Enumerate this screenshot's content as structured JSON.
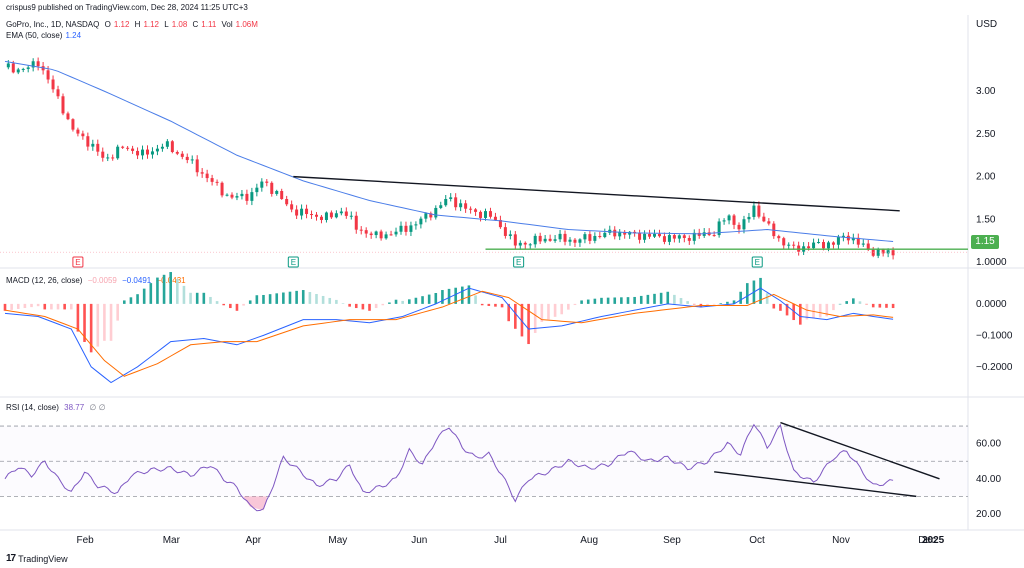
{
  "publisher": "crispus9 published on TradingView.com, Dec 28, 2024 11:25 UTC+3",
  "brand": "TradingView",
  "colors": {
    "up": "#089981",
    "down": "#f23645",
    "ema": "#4a7de8",
    "macd": "#2962ff",
    "signal": "#ff6d00",
    "rsi": "#7e57c2",
    "support": "#4caf50"
  },
  "header": {
    "symbol": "GoPro, Inc., 1D, NASDAQ",
    "o_label": "O",
    "o": "1.12",
    "h_label": "H",
    "h": "1.12",
    "l_label": "L",
    "l": "1.08",
    "c_label": "C",
    "c": "1.11",
    "vol_label": "Vol",
    "vol": "1.06M",
    "ema_label": "EMA (50, close)",
    "ema": "1.24"
  },
  "macd_header": {
    "label": "MACD (12, 26, close)",
    "hist": "−0.0059",
    "macd": "−0.0491",
    "signal": "−0.0431"
  },
  "rsi_header": {
    "label": "RSI (14, close)",
    "value": "38.77",
    "extra": "∅ ∅"
  },
  "currency": "USD",
  "price_tag": "1.15",
  "earnings_marker": "E",
  "chart_data": [
    {
      "type": "candlestick",
      "title": "GoPro, Inc., 1D, NASDAQ",
      "y_ticks": [
        "3.00",
        "2.50",
        "2.00",
        "1.50",
        "1.0000"
      ],
      "ylim": [
        1.0,
        3.6
      ],
      "x_labels": [
        "Feb",
        "Mar",
        "Apr",
        "May",
        "Jun",
        "Jul",
        "Aug",
        "Sep",
        "Oct",
        "Nov",
        "Dec",
        "2025"
      ],
      "price_anchors": [
        {
          "d": 0,
          "c": 3.28
        },
        {
          "d": 6,
          "c": 3.25
        },
        {
          "d": 10,
          "c": 3.35
        },
        {
          "d": 14,
          "c": 3.05
        },
        {
          "d": 17,
          "c": 2.85
        },
        {
          "d": 20,
          "c": 2.55
        },
        {
          "d": 24,
          "c": 2.45
        },
        {
          "d": 30,
          "c": 2.2
        },
        {
          "d": 36,
          "c": 2.35
        },
        {
          "d": 42,
          "c": 2.25
        },
        {
          "d": 48,
          "c": 2.38
        },
        {
          "d": 55,
          "c": 2.2
        },
        {
          "d": 62,
          "c": 1.95
        },
        {
          "d": 68,
          "c": 1.75
        },
        {
          "d": 74,
          "c": 1.78
        },
        {
          "d": 78,
          "c": 1.95
        },
        {
          "d": 82,
          "c": 1.8
        },
        {
          "d": 86,
          "c": 1.62
        },
        {
          "d": 92,
          "c": 1.55
        },
        {
          "d": 98,
          "c": 1.52
        },
        {
          "d": 102,
          "c": 1.62
        },
        {
          "d": 106,
          "c": 1.4
        },
        {
          "d": 112,
          "c": 1.3
        },
        {
          "d": 118,
          "c": 1.35
        },
        {
          "d": 124,
          "c": 1.45
        },
        {
          "d": 130,
          "c": 1.62
        },
        {
          "d": 134,
          "c": 1.75
        },
        {
          "d": 140,
          "c": 1.6
        },
        {
          "d": 146,
          "c": 1.55
        },
        {
          "d": 150,
          "c": 1.4
        },
        {
          "d": 154,
          "c": 1.2
        },
        {
          "d": 160,
          "c": 1.25
        },
        {
          "d": 166,
          "c": 1.28
        },
        {
          "d": 172,
          "c": 1.25
        },
        {
          "d": 178,
          "c": 1.3
        },
        {
          "d": 184,
          "c": 1.35
        },
        {
          "d": 190,
          "c": 1.32
        },
        {
          "d": 196,
          "c": 1.3
        },
        {
          "d": 202,
          "c": 1.28
        },
        {
          "d": 208,
          "c": 1.3
        },
        {
          "d": 214,
          "c": 1.35
        },
        {
          "d": 218,
          "c": 1.55
        },
        {
          "d": 222,
          "c": 1.38
        },
        {
          "d": 226,
          "c": 1.65
        },
        {
          "d": 230,
          "c": 1.42
        },
        {
          "d": 234,
          "c": 1.25
        },
        {
          "d": 238,
          "c": 1.15
        },
        {
          "d": 244,
          "c": 1.2
        },
        {
          "d": 250,
          "c": 1.22
        },
        {
          "d": 254,
          "c": 1.32
        },
        {
          "d": 258,
          "c": 1.2
        },
        {
          "d": 262,
          "c": 1.12
        },
        {
          "d": 268,
          "c": 1.1
        }
      ],
      "ema_anchors": [
        {
          "d": 0,
          "v": 3.35
        },
        {
          "d": 15,
          "v": 3.25
        },
        {
          "d": 30,
          "v": 3.0
        },
        {
          "d": 50,
          "v": 2.65
        },
        {
          "d": 70,
          "v": 2.25
        },
        {
          "d": 90,
          "v": 1.95
        },
        {
          "d": 110,
          "v": 1.72
        },
        {
          "d": 130,
          "v": 1.55
        },
        {
          "d": 150,
          "v": 1.48
        },
        {
          "d": 170,
          "v": 1.38
        },
        {
          "d": 190,
          "v": 1.34
        },
        {
          "d": 210,
          "v": 1.33
        },
        {
          "d": 230,
          "v": 1.38
        },
        {
          "d": 250,
          "v": 1.3
        },
        {
          "d": 268,
          "v": 1.24
        }
      ],
      "support_line": {
        "value": 1.15,
        "from_day": 145
      },
      "resistance_line": {
        "from": {
          "d": 87,
          "v": 2.0
        },
        "to": {
          "d": 270,
          "v": 1.6
        }
      },
      "earnings_days": [
        22,
        87,
        155,
        227
      ]
    },
    {
      "type": "macd",
      "title": "MACD (12, 26, close)",
      "y_ticks": [
        "0.0000",
        "−0.1000",
        "−0.2000"
      ],
      "ylim": [
        -0.28,
        0.06
      ],
      "macd_anchors": [
        {
          "d": 0,
          "v": -0.03
        },
        {
          "d": 10,
          "v": -0.04
        },
        {
          "d": 20,
          "v": -0.08
        },
        {
          "d": 26,
          "v": -0.2
        },
        {
          "d": 32,
          "v": -0.25
        },
        {
          "d": 40,
          "v": -0.2
        },
        {
          "d": 50,
          "v": -0.12
        },
        {
          "d": 60,
          "v": -0.11
        },
        {
          "d": 70,
          "v": -0.13
        },
        {
          "d": 78,
          "v": -0.1
        },
        {
          "d": 90,
          "v": -0.05
        },
        {
          "d": 100,
          "v": -0.05
        },
        {
          "d": 110,
          "v": -0.06
        },
        {
          "d": 120,
          "v": -0.04
        },
        {
          "d": 130,
          "v": 0.0
        },
        {
          "d": 140,
          "v": 0.05
        },
        {
          "d": 150,
          "v": 0.02
        },
        {
          "d": 158,
          "v": -0.08
        },
        {
          "d": 168,
          "v": -0.07
        },
        {
          "d": 180,
          "v": -0.04
        },
        {
          "d": 200,
          "v": 0.0
        },
        {
          "d": 210,
          "v": -0.01
        },
        {
          "d": 220,
          "v": 0.0
        },
        {
          "d": 228,
          "v": 0.05
        },
        {
          "d": 234,
          "v": 0.01
        },
        {
          "d": 240,
          "v": -0.04
        },
        {
          "d": 248,
          "v": -0.05
        },
        {
          "d": 256,
          "v": -0.03
        },
        {
          "d": 262,
          "v": -0.04
        },
        {
          "d": 268,
          "v": -0.049
        }
      ],
      "signal_anchors": [
        {
          "d": 0,
          "v": -0.02
        },
        {
          "d": 12,
          "v": -0.04
        },
        {
          "d": 22,
          "v": -0.08
        },
        {
          "d": 30,
          "v": -0.18
        },
        {
          "d": 36,
          "v": -0.23
        },
        {
          "d": 46,
          "v": -0.19
        },
        {
          "d": 56,
          "v": -0.13
        },
        {
          "d": 66,
          "v": -0.12
        },
        {
          "d": 76,
          "v": -0.12
        },
        {
          "d": 90,
          "v": -0.07
        },
        {
          "d": 104,
          "v": -0.05
        },
        {
          "d": 118,
          "v": -0.05
        },
        {
          "d": 132,
          "v": -0.01
        },
        {
          "d": 144,
          "v": 0.04
        },
        {
          "d": 152,
          "v": 0.02
        },
        {
          "d": 162,
          "v": -0.05
        },
        {
          "d": 174,
          "v": -0.06
        },
        {
          "d": 190,
          "v": -0.03
        },
        {
          "d": 210,
          "v": -0.005
        },
        {
          "d": 224,
          "v": -0.005
        },
        {
          "d": 232,
          "v": 0.03
        },
        {
          "d": 242,
          "v": -0.02
        },
        {
          "d": 252,
          "v": -0.04
        },
        {
          "d": 262,
          "v": -0.035
        },
        {
          "d": 268,
          "v": -0.043
        }
      ]
    },
    {
      "type": "rsi",
      "title": "RSI (14, close)",
      "y_ticks": [
        "60.00",
        "40.00",
        "20.00"
      ],
      "ylim": [
        12,
        82
      ],
      "bands": [
        70,
        50,
        30
      ],
      "rsi_anchors": [
        {
          "d": 0,
          "v": 40
        },
        {
          "d": 4,
          "v": 47
        },
        {
          "d": 8,
          "v": 42
        },
        {
          "d": 12,
          "v": 50
        },
        {
          "d": 16,
          "v": 40
        },
        {
          "d": 20,
          "v": 32
        },
        {
          "d": 24,
          "v": 44
        },
        {
          "d": 28,
          "v": 36
        },
        {
          "d": 34,
          "v": 32
        },
        {
          "d": 38,
          "v": 42
        },
        {
          "d": 44,
          "v": 45
        },
        {
          "d": 50,
          "v": 46
        },
        {
          "d": 56,
          "v": 42
        },
        {
          "d": 62,
          "v": 48
        },
        {
          "d": 66,
          "v": 40
        },
        {
          "d": 70,
          "v": 35
        },
        {
          "d": 74,
          "v": 24
        },
        {
          "d": 78,
          "v": 22
        },
        {
          "d": 84,
          "v": 52
        },
        {
          "d": 88,
          "v": 46
        },
        {
          "d": 94,
          "v": 36
        },
        {
          "d": 100,
          "v": 40
        },
        {
          "d": 104,
          "v": 48
        },
        {
          "d": 108,
          "v": 32
        },
        {
          "d": 114,
          "v": 36
        },
        {
          "d": 118,
          "v": 40
        },
        {
          "d": 122,
          "v": 56
        },
        {
          "d": 126,
          "v": 48
        },
        {
          "d": 130,
          "v": 62
        },
        {
          "d": 134,
          "v": 70
        },
        {
          "d": 138,
          "v": 58
        },
        {
          "d": 142,
          "v": 52
        },
        {
          "d": 146,
          "v": 54
        },
        {
          "d": 150,
          "v": 42
        },
        {
          "d": 154,
          "v": 28
        },
        {
          "d": 158,
          "v": 40
        },
        {
          "d": 164,
          "v": 44
        },
        {
          "d": 170,
          "v": 50
        },
        {
          "d": 176,
          "v": 46
        },
        {
          "d": 182,
          "v": 48
        },
        {
          "d": 188,
          "v": 56
        },
        {
          "d": 194,
          "v": 50
        },
        {
          "d": 200,
          "v": 52
        },
        {
          "d": 206,
          "v": 46
        },
        {
          "d": 212,
          "v": 50
        },
        {
          "d": 218,
          "v": 60
        },
        {
          "d": 222,
          "v": 54
        },
        {
          "d": 226,
          "v": 72
        },
        {
          "d": 230,
          "v": 58
        },
        {
          "d": 234,
          "v": 70
        },
        {
          "d": 238,
          "v": 44
        },
        {
          "d": 244,
          "v": 38
        },
        {
          "d": 250,
          "v": 52
        },
        {
          "d": 254,
          "v": 56
        },
        {
          "d": 258,
          "v": 46
        },
        {
          "d": 262,
          "v": 36
        },
        {
          "d": 268,
          "v": 38.77
        }
      ],
      "trend_upper": {
        "from": {
          "d": 234,
          "v": 72
        },
        "to": {
          "d": 282,
          "v": 40
        }
      },
      "trend_lower": {
        "from": {
          "d": 214,
          "v": 44
        },
        "to": {
          "d": 275,
          "v": 30
        }
      }
    }
  ]
}
